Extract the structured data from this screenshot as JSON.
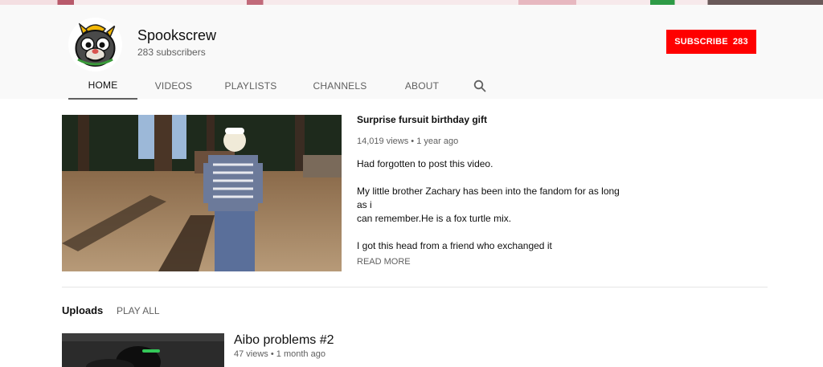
{
  "channel": {
    "name": "Spookscrew",
    "subscribers_text": "283 subscribers",
    "subscribe_label": "Subscribe",
    "subscribe_count": "283"
  },
  "tabs": [
    {
      "label": "Home",
      "active": true
    },
    {
      "label": "Videos",
      "active": false
    },
    {
      "label": "Playlists",
      "active": false
    },
    {
      "label": "Channels",
      "active": false
    },
    {
      "label": "About",
      "active": false
    }
  ],
  "search_icon": "search-icon",
  "featured_video": {
    "title": "Surprise fursuit birthday gift",
    "views": "14,019 views",
    "age": "1 year ago",
    "description": [
      "Had forgotten to post this video.",
      "",
      "My little brother Zachary has been into the fandom for as long as i",
      "can remember.He is a fox turtle mix.",
      "",
      "I got this head from a friend who exchanged it"
    ],
    "read_more": "Read more"
  },
  "uploads": {
    "title": "Uploads",
    "play_all": "Play all",
    "items": [
      {
        "title": "Aibo problems #2",
        "views": "47 views",
        "age": "1 month ago"
      }
    ]
  },
  "colors": {
    "subscribe": "#ff0000",
    "header_bg": "#f9f9f9",
    "secondary_text": "#606060"
  }
}
